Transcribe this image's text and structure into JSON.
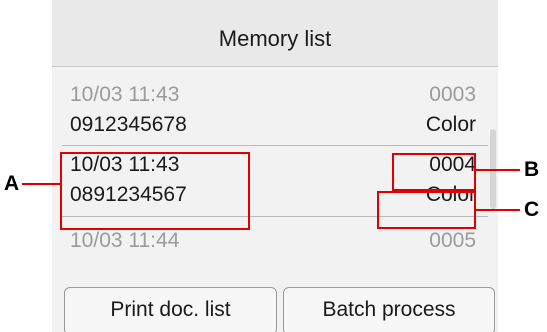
{
  "header": {
    "title": "Memory list"
  },
  "rows": [
    {
      "datetime": "10/03 11:43",
      "number": "0912345678",
      "id": "0003",
      "mode": "Color"
    },
    {
      "datetime": "10/03 11:43",
      "number": "0891234567",
      "id": "0004",
      "mode": "Color"
    },
    {
      "datetime": "10/03 11:44",
      "id": "0005"
    }
  ],
  "buttons": {
    "print_doc_list": "Print doc. list",
    "batch_process": "Batch process"
  },
  "callouts": {
    "a": "A",
    "b": "B",
    "c": "C"
  },
  "colors": {
    "highlight": "#e00000"
  }
}
